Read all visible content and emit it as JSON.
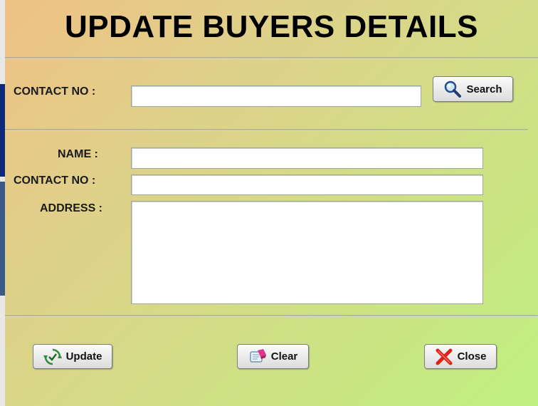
{
  "window": {
    "title": "UPDATE BUYERS DETAILS"
  },
  "search": {
    "contact_label": "CONTACT NO :",
    "contact_value": "",
    "search_label": "Search",
    "search_icon": "magnifier-icon"
  },
  "details": {
    "name_label": "NAME :",
    "name_value": "",
    "contact_label": "CONTACT NO :",
    "contact_value": "",
    "address_label": "ADDRESS :",
    "address_value": ""
  },
  "actions": {
    "update_label": "Update",
    "update_icon": "refresh-check-icon",
    "clear_label": "Clear",
    "clear_icon": "eraser-icon",
    "close_label": "Close",
    "close_icon": "red-x-icon"
  },
  "colors": {
    "gradient_start": "#efc184",
    "gradient_end": "#bff080"
  }
}
